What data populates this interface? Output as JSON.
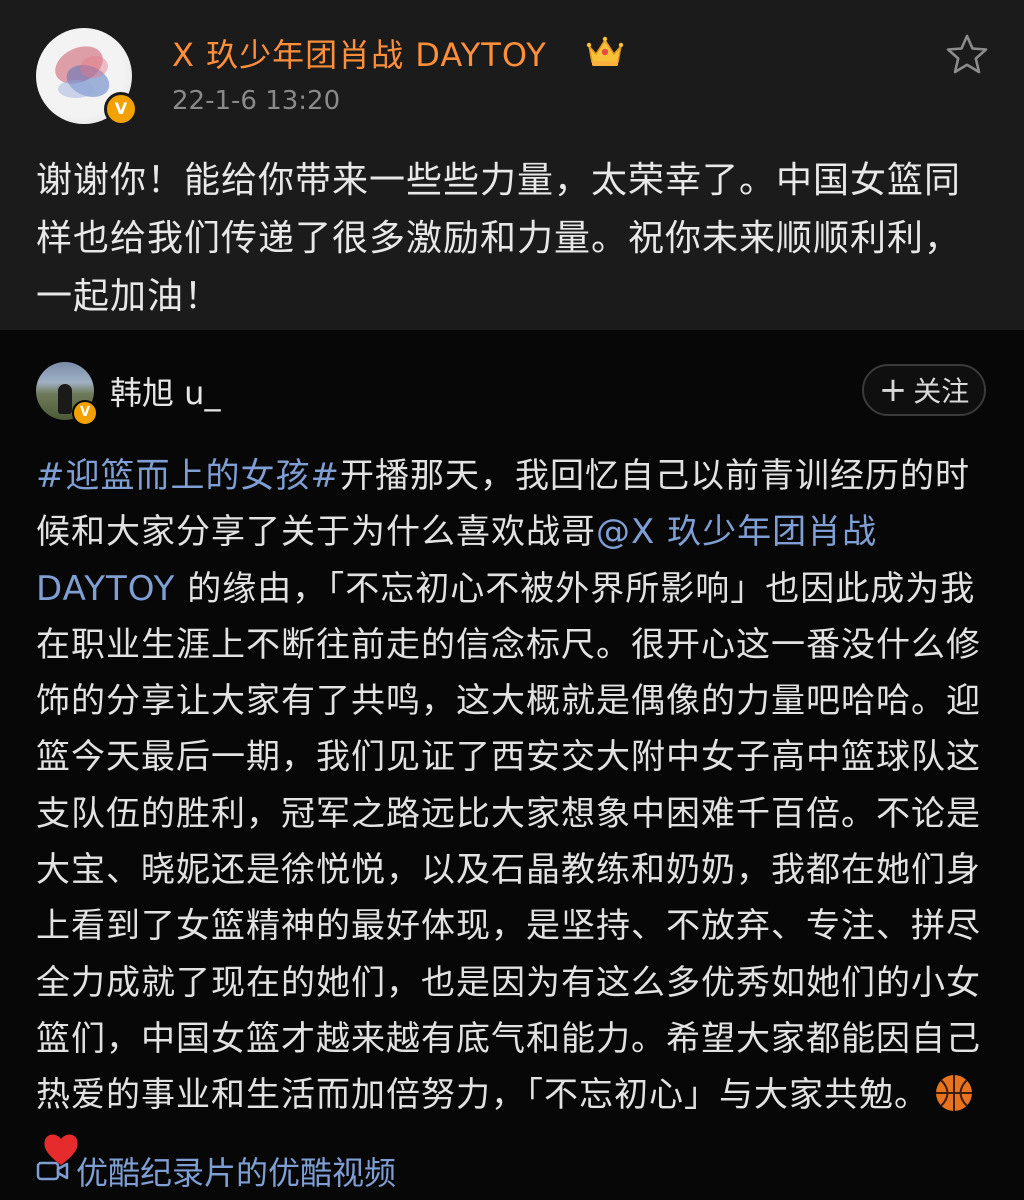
{
  "reply_post": {
    "author_name": "X 玖少年团肖战 DAYTOY",
    "timestamp": "22-1-6 13:20",
    "content": "谢谢你！能给你带来一些些力量，太荣幸了。中国女篮同样也给我们传递了很多激励和力量。祝你未来顺顺利利，一起加油！",
    "verified_badge": "V",
    "icons": [
      "avatar",
      "crown-icon",
      "star-icon"
    ],
    "accent_colors": {
      "name": "#ff8f3a",
      "badge": "#f2a100"
    }
  },
  "original_post": {
    "author_name": "韩旭 u_",
    "verified_badge": "V",
    "follow_button": {
      "plus": "+",
      "label": "关注"
    },
    "content": {
      "hashtag": "#迎篮而上的女孩#",
      "text_1": "开播那天，我回忆自己以前青训经历的时候和大家分享了关于为什么喜欢战哥",
      "mention": "@X 玖少年团肖战 DAYTOY",
      "text_2": " 的缘由，「不忘初心不被外界所影响」也因此成为我在职业生涯上不断往前走的信念标尺。很开心这一番没什么修饰的分享让大家有了共鸣，这大概就是偶像的力量吧哈哈。迎篮今天最后一期，我们见证了西安交大附中女子高中篮球队这支队伍的胜利，冠军之路远比大家想象中困难千百倍。不论是大宝、晓妮还是徐悦悦，以及石晶教练和奶奶，我都在她们身上看到了女篮精神的最好体现，是坚持、不放弃、专注、拼尽全力成就了现在的她们，也是因为有这么多优秀如她们的小女篮们，中国女篮才越来越有底气和能力。希望大家都能因自己热爱的事业和生活而加倍努力，「不忘初心」与大家共勉。",
      "emojis": [
        "basketball-emoji",
        "red-heart-emoji"
      ]
    },
    "video_link": "优酷纪录片的优酷视频",
    "link_color": "#7f9fd4"
  }
}
